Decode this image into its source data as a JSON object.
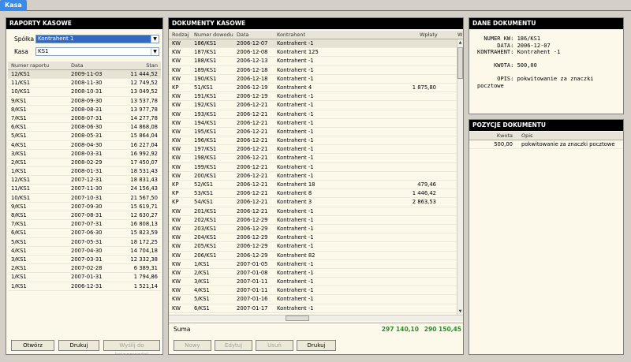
{
  "tab": {
    "label": "Kasa"
  },
  "raporty": {
    "title": "RAPORTY KASOWE",
    "spolka_label": "Spółka",
    "spolka_value": "Kontrahent 1",
    "kasa_label": "Kasa",
    "kasa_value": "KS1",
    "columns": [
      "Numer raportu",
      "Data",
      "Stan"
    ],
    "rows": [
      [
        "12/KS1",
        "2009-11-03",
        "11 444,52"
      ],
      [
        "11/KS1",
        "2008-11-30",
        "12 749,52"
      ],
      [
        "10/KS1",
        "2008-10-31",
        "13 049,52"
      ],
      [
        "9/KS1",
        "2008-09-30",
        "13 537,78"
      ],
      [
        "8/KS1",
        "2008-08-31",
        "13 977,78"
      ],
      [
        "7/KS1",
        "2008-07-31",
        "14 277,78"
      ],
      [
        "6/KS1",
        "2008-06-30",
        "14 868,08"
      ],
      [
        "5/KS1",
        "2008-05-31",
        "15 864,04"
      ],
      [
        "4/KS1",
        "2008-04-30",
        "16 227,04"
      ],
      [
        "3/KS1",
        "2008-03-31",
        "16 992,92"
      ],
      [
        "2/KS1",
        "2008-02-29",
        "17 450,07"
      ],
      [
        "1/KS1",
        "2008-01-31",
        "18 531,43"
      ],
      [
        "12/KS1",
        "2007-12-31",
        "18 831,43"
      ],
      [
        "11/KS1",
        "2007-11-30",
        "24 156,43"
      ],
      [
        "10/KS1",
        "2007-10-31",
        "21 567,50"
      ],
      [
        "9/KS1",
        "2007-09-30",
        "15 619,71"
      ],
      [
        "8/KS1",
        "2007-08-31",
        "12 630,27"
      ],
      [
        "7/KS1",
        "2007-07-31",
        "16 808,13"
      ],
      [
        "6/KS1",
        "2007-06-30",
        "15 823,59"
      ],
      [
        "5/KS1",
        "2007-05-31",
        "18 172,25"
      ],
      [
        "4/KS1",
        "2007-04-30",
        "14 704,18"
      ],
      [
        "3/KS1",
        "2007-03-31",
        "12 332,38"
      ],
      [
        "2/KS1",
        "2007-02-28",
        "6 389,31"
      ],
      [
        "1/KS1",
        "2007-01-31",
        "1 794,86"
      ],
      [
        "1/KS1",
        "2006-12-31",
        "1 521,14"
      ]
    ],
    "buttons": {
      "otworz": "Otwórz",
      "drukuj": "Drukuj",
      "wyslij": "Wyślij do księgowości"
    }
  },
  "dokumenty": {
    "title": "DOKUMENTY KASOWE",
    "columns": [
      "Rodzaj",
      "Numer dowodu",
      "Data",
      "Kontrahent",
      "Wpłaty",
      "W"
    ],
    "rows": [
      [
        "KW",
        "186/KS1",
        "2006-12-07",
        "Kontrahent -1",
        ""
      ],
      [
        "KW",
        "187/KS1",
        "2006-12-08",
        "Kontrahent 125",
        ""
      ],
      [
        "KW",
        "188/KS1",
        "2006-12-13",
        "Kontrahent -1",
        ""
      ],
      [
        "KW",
        "189/KS1",
        "2006-12-18",
        "Kontrahent -1",
        ""
      ],
      [
        "KW",
        "190/KS1",
        "2006-12-18",
        "Kontrahent -1",
        ""
      ],
      [
        "KP",
        "51/KS1",
        "2006-12-19",
        "Kontrahent 4",
        "1 875,80"
      ],
      [
        "KW",
        "191/KS1",
        "2006-12-19",
        "Kontrahent -1",
        ""
      ],
      [
        "KW",
        "192/KS1",
        "2006-12-21",
        "Kontrahent -1",
        ""
      ],
      [
        "KW",
        "193/KS1",
        "2006-12-21",
        "Kontrahent -1",
        ""
      ],
      [
        "KW",
        "194/KS1",
        "2006-12-21",
        "Kontrahent -1",
        ""
      ],
      [
        "KW",
        "195/KS1",
        "2006-12-21",
        "Kontrahent -1",
        ""
      ],
      [
        "KW",
        "196/KS1",
        "2006-12-21",
        "Kontrahent -1",
        ""
      ],
      [
        "KW",
        "197/KS1",
        "2006-12-21",
        "Kontrahent -1",
        ""
      ],
      [
        "KW",
        "198/KS1",
        "2006-12-21",
        "Kontrahent -1",
        ""
      ],
      [
        "KW",
        "199/KS1",
        "2006-12-21",
        "Kontrahent -1",
        ""
      ],
      [
        "KW",
        "200/KS1",
        "2006-12-21",
        "Kontrahent -1",
        ""
      ],
      [
        "KP",
        "52/KS1",
        "2006-12-21",
        "Kontrahent 18",
        "479,46"
      ],
      [
        "KP",
        "53/KS1",
        "2006-12-21",
        "Kontrahent 8",
        "1 446,42"
      ],
      [
        "KP",
        "54/KS1",
        "2006-12-21",
        "Kontrahent 3",
        "2 863,53"
      ],
      [
        "KW",
        "201/KS1",
        "2006-12-21",
        "Kontrahent -1",
        ""
      ],
      [
        "KW",
        "202/KS1",
        "2006-12-29",
        "Kontrahent -1",
        ""
      ],
      [
        "KW",
        "203/KS1",
        "2006-12-29",
        "Kontrahent -1",
        ""
      ],
      [
        "KW",
        "204/KS1",
        "2006-12-29",
        "Kontrahent -1",
        ""
      ],
      [
        "KW",
        "205/KS1",
        "2006-12-29",
        "Kontrahent -1",
        ""
      ],
      [
        "KW",
        "206/KS1",
        "2006-12-29",
        "Kontrahent 82",
        ""
      ],
      [
        "KW",
        "1/KS1",
        "2007-01-05",
        "Kontrahent -1",
        ""
      ],
      [
        "KW",
        "2/KS1",
        "2007-01-08",
        "Kontrahent -1",
        ""
      ],
      [
        "KW",
        "3/KS1",
        "2007-01-11",
        "Kontrahent -1",
        ""
      ],
      [
        "KW",
        "4/KS1",
        "2007-01-11",
        "Kontrahent -1",
        ""
      ],
      [
        "KW",
        "5/KS1",
        "2007-01-16",
        "Kontrahent -1",
        ""
      ],
      [
        "KW",
        "6/KS1",
        "2007-01-17",
        "Kontrahent -1",
        ""
      ]
    ],
    "suma_label": "Suma",
    "suma_wplaty": "297 140,10",
    "suma_wyplaty": "290 150,45",
    "buttons": {
      "nowy": "Nowy",
      "edytuj": "Edytuj",
      "usun": "Usuń",
      "drukuj": "Drukuj"
    }
  },
  "dane": {
    "title": "DANE DOKUMENTU",
    "text": "  NUMER KW: 186/KS1\n      DATA: 2006-12-07\nKONTRAHENT: Kontrahent -1\n\n     KWOTA: 500,00\n\n      OPIS: pokwitowanie za znaczki\npocztowe"
  },
  "pozycje": {
    "title": "POZYCJE DOKUMENTU",
    "columns": [
      "Kwota",
      "Opis"
    ],
    "rows": [
      [
        "500,00",
        "pokwitowanie za znaczki pocztowe"
      ]
    ]
  }
}
